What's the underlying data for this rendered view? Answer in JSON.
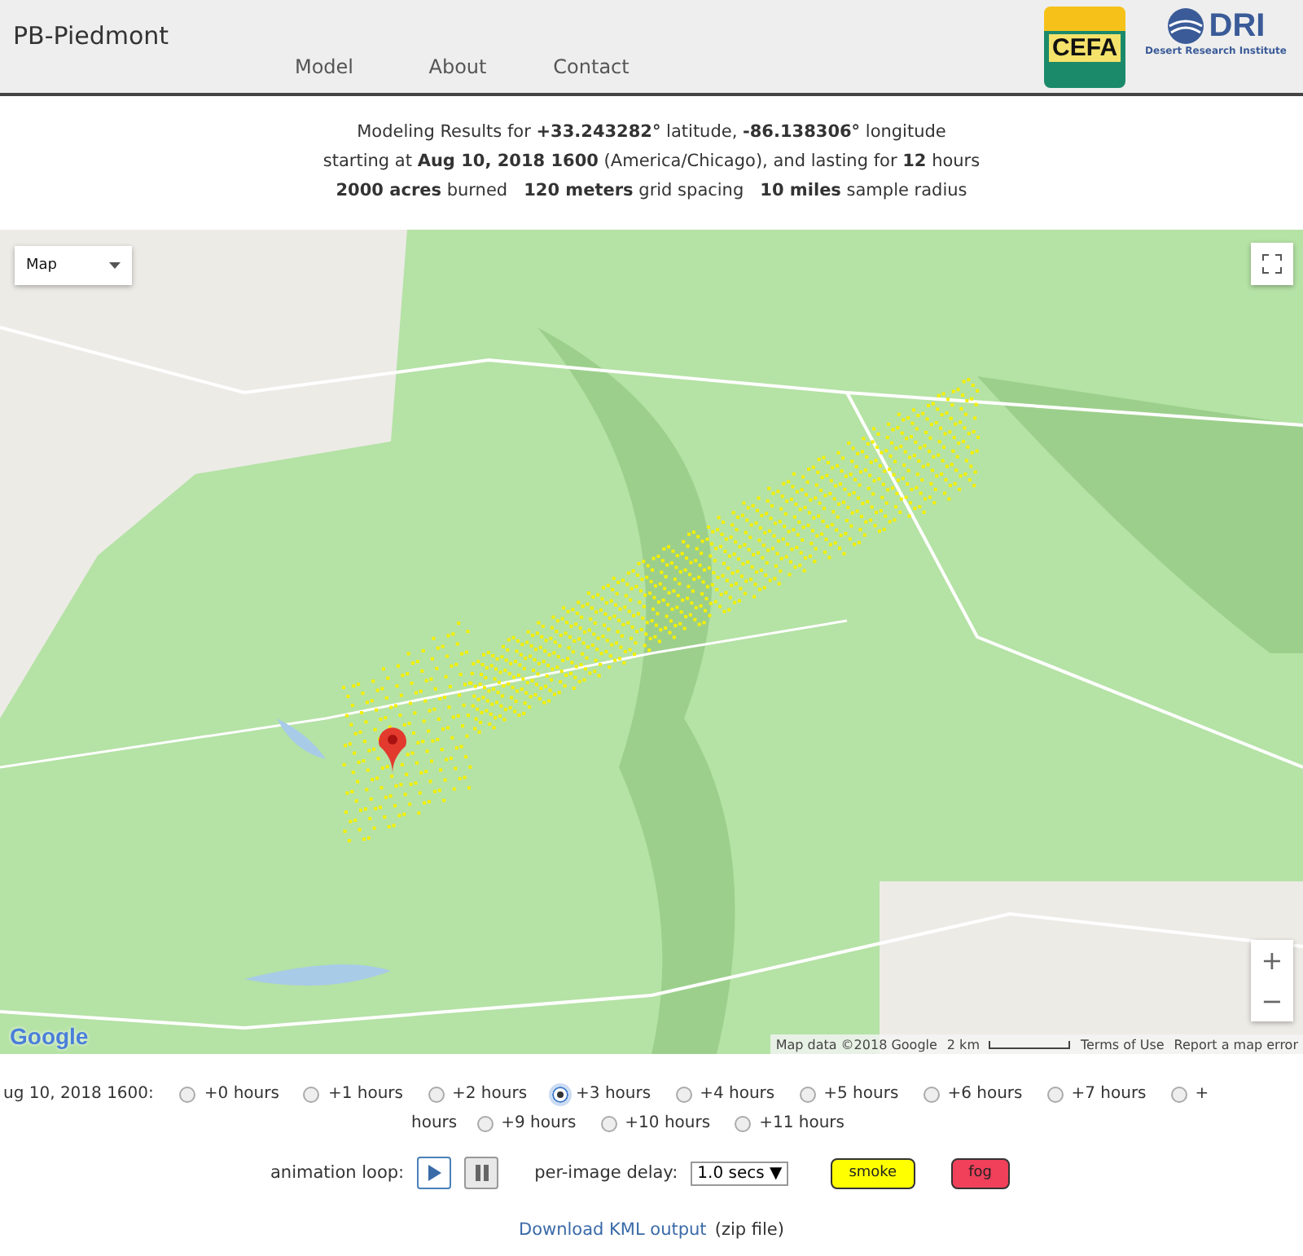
{
  "brand": "PB-Piedmont",
  "nav": [
    {
      "label": "Model"
    },
    {
      "label": "About"
    },
    {
      "label": "Contact"
    }
  ],
  "logos": [
    {
      "kind": "cefa",
      "text": "CEFA"
    },
    {
      "kind": "dri",
      "text": "DRI",
      "caption": "Desert Research Institute"
    }
  ],
  "summary": [
    "Modeling Results for **+33.243282°** latitude, **-86.138306°** longitude",
    "starting at **Aug 10, 2018 1600** (America/Chicago), and lasting for **12** hours",
    "**2000 acres** burned   **120 meters** grid spacing   **10 miles** sample radius"
  ],
  "map": {
    "type_control": "Map",
    "zoom_in": "+",
    "zoom_out": "−",
    "attribution": "Map data ©2018 Google",
    "scale": "2 km",
    "terms": "Terms of Use",
    "report": "Report a map error",
    "logo": "Google"
  },
  "time_rows": [
    {
      "lead": "ug 10, 2018 1600:",
      "options": [
        {
          "label": "+0 hours",
          "selected": false
        },
        {
          "label": "+1 hours",
          "selected": false
        },
        {
          "label": "+2 hours",
          "selected": false
        },
        {
          "label": "+3 hours",
          "selected": true
        },
        {
          "label": "+4 hours",
          "selected": false
        },
        {
          "label": "+5 hours",
          "selected": false
        },
        {
          "label": "+6 hours",
          "selected": false
        },
        {
          "label": "+7 hours",
          "selected": false
        },
        {
          "label": "+",
          "selected": false
        }
      ]
    },
    {
      "lead": "hours",
      "options": [
        {
          "label": "+9 hours",
          "selected": false
        },
        {
          "label": "+10 hours",
          "selected": false
        },
        {
          "label": "+11 hours",
          "selected": false
        }
      ]
    }
  ],
  "animation": {
    "label": "animation loop:",
    "delay_label": "per-image delay:",
    "delay_value": "1.0 secs ▼"
  },
  "layers": [
    {
      "label": "smoke",
      "color": "#ffff00"
    },
    {
      "label": "fog",
      "color": "#f0405a"
    }
  ],
  "download": {
    "link": "Download KML output",
    "note": "(zip file)"
  }
}
